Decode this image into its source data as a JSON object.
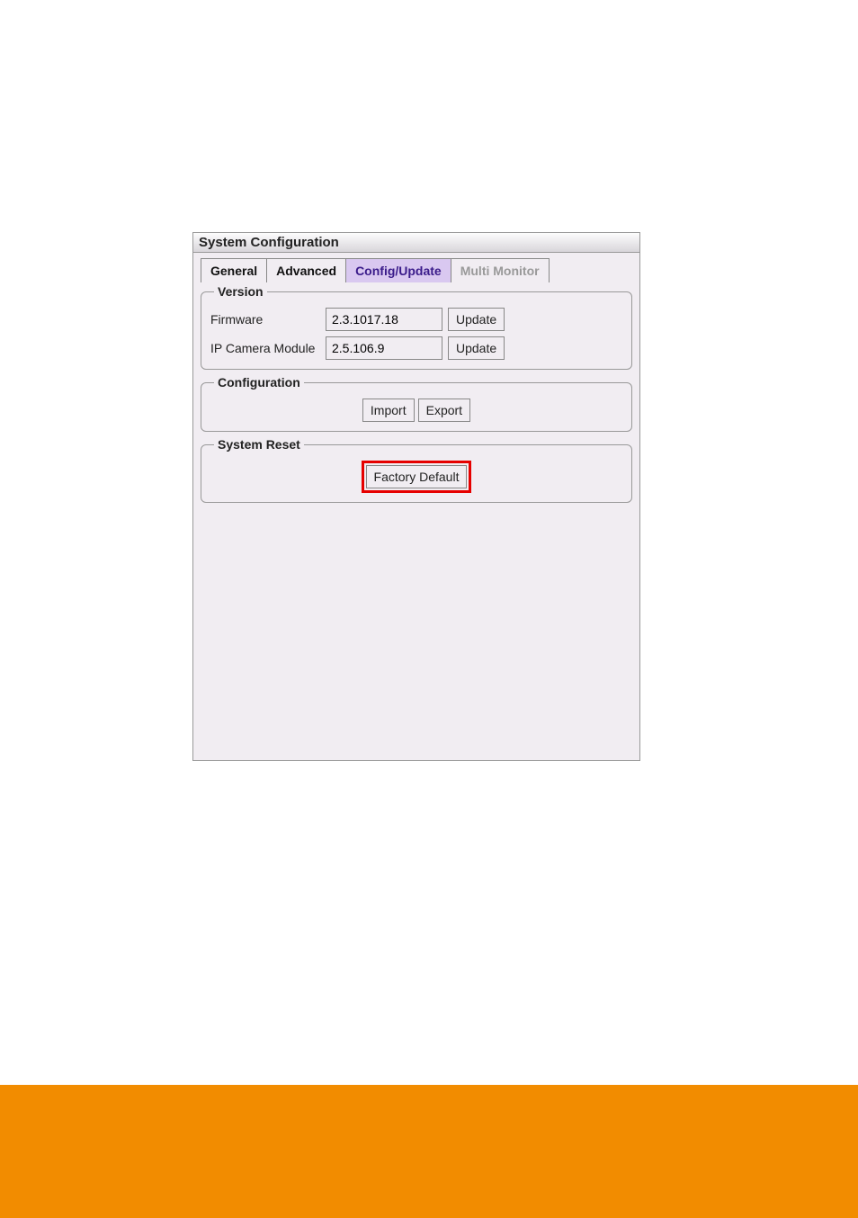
{
  "window": {
    "title": "System Configuration"
  },
  "tabs": {
    "general": "General",
    "advanced": "Advanced",
    "configUpdate": "Config/Update",
    "multiMonitor": "Multi Monitor"
  },
  "version": {
    "legend": "Version",
    "firmwareLabel": "Firmware",
    "firmwareValue": "2.3.1017.18",
    "firmwareUpdate": "Update",
    "ipCamLabel": "IP Camera Module",
    "ipCamValue": "2.5.106.9",
    "ipCamUpdate": "Update"
  },
  "configuration": {
    "legend": "Configuration",
    "import": "Import",
    "export": "Export"
  },
  "systemReset": {
    "legend": "System Reset",
    "factoryDefault": "Factory Default"
  }
}
